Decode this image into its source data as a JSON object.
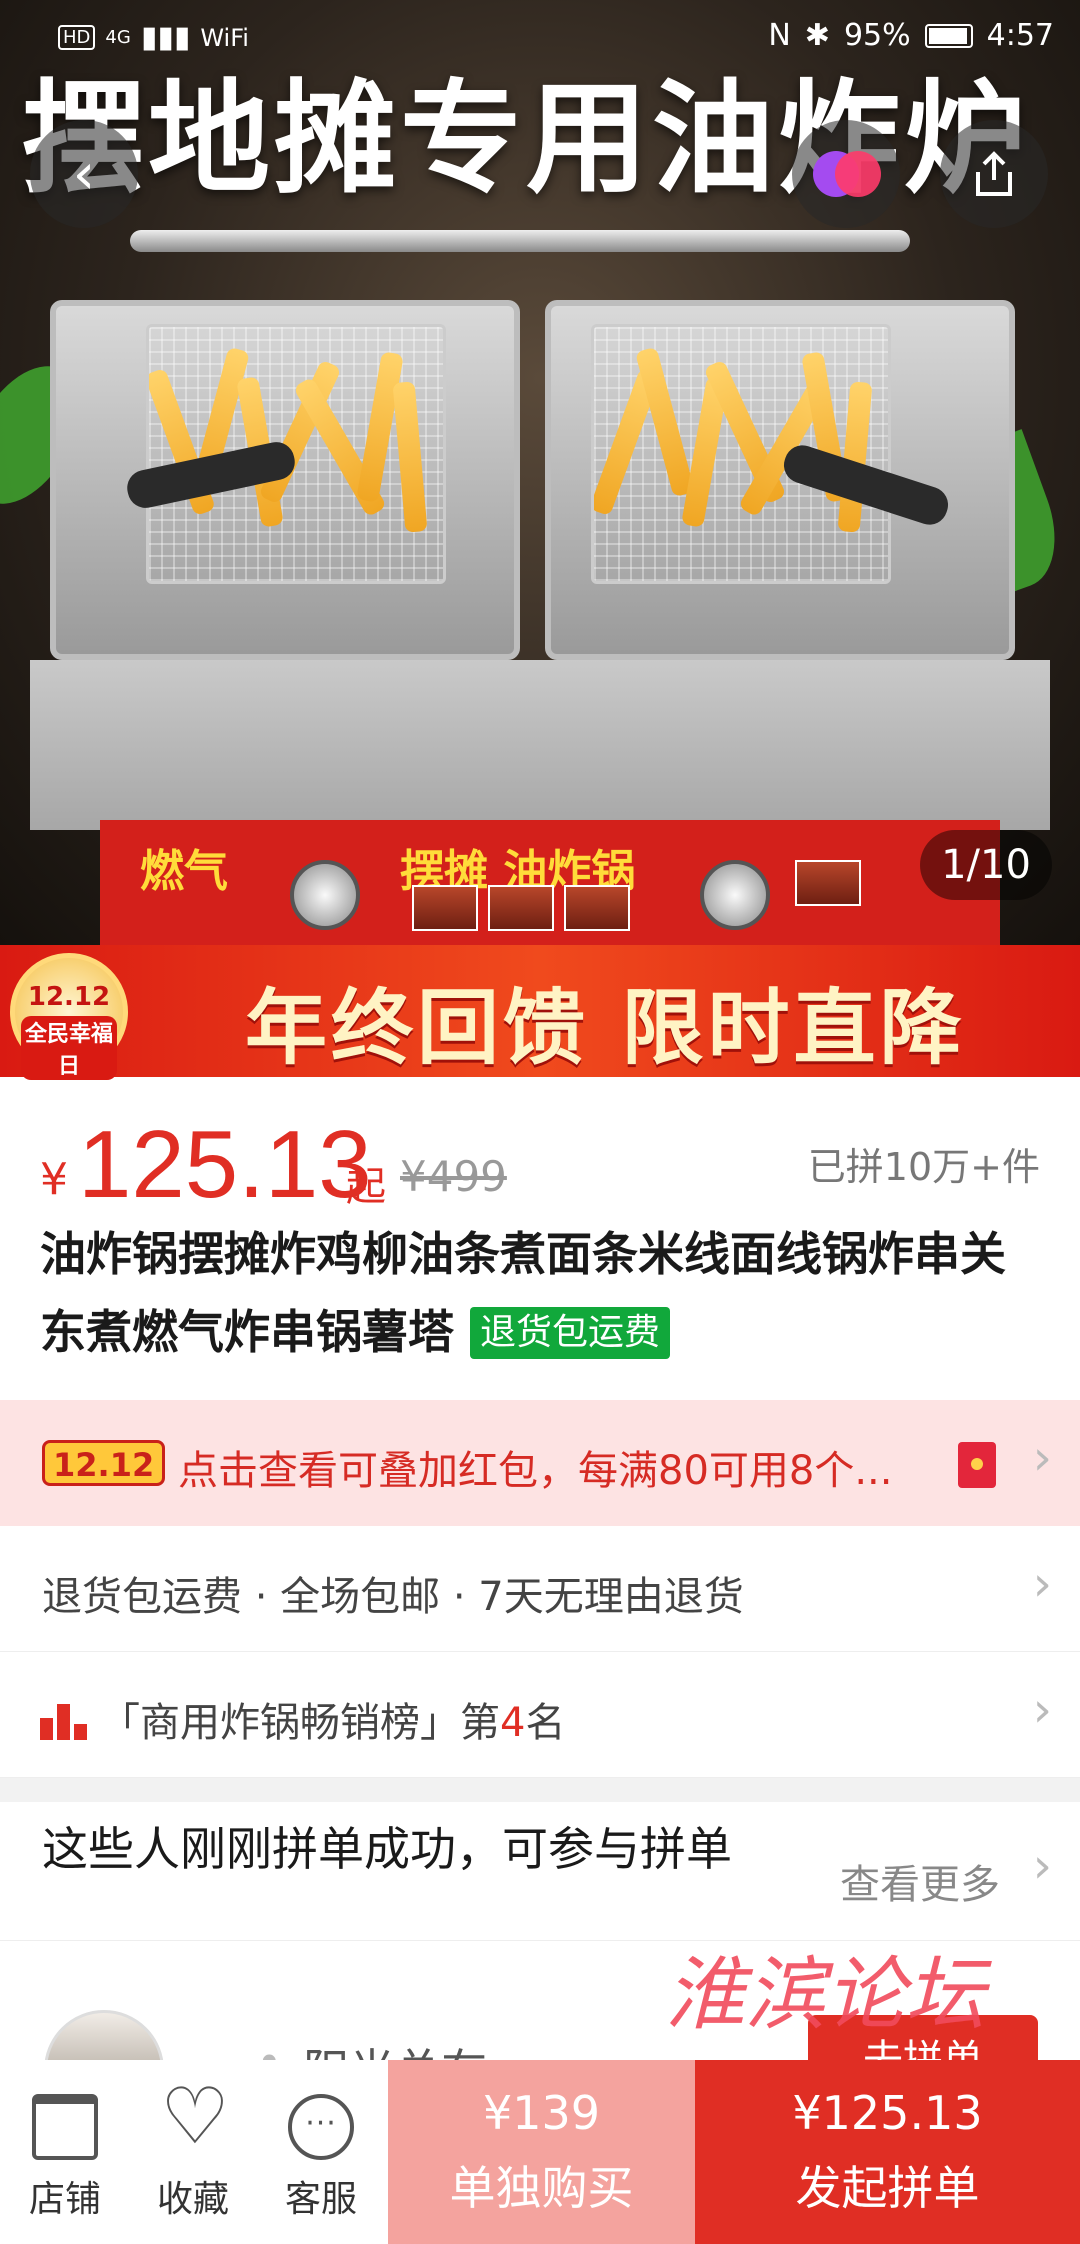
{
  "status_bar": {
    "left": [
      "HD",
      "4G",
      "▮▮▮",
      "WiFi"
    ],
    "battery": "95%",
    "time": "4:57"
  },
  "hero": {
    "title": "摆地摊专用油炸炉",
    "panel_left": "燃气",
    "panel_center": "摆摊 油炸锅",
    "counter": "1/10"
  },
  "header_buttons": {
    "back_icon": "chevron-left-icon",
    "mode_icon": "dual-circle-icon",
    "share_icon": "share-icon"
  },
  "promo_banner": {
    "badge_top": "12.12",
    "badge_bottom": "全民幸福日",
    "text": "年终回馈 限时直降"
  },
  "price": {
    "currency": "¥",
    "value": "125.13",
    "suffix": "起",
    "original": "¥499",
    "sold": "已拼10万+件"
  },
  "product": {
    "title": "油炸锅摆摊炸鸡柳油条煮面条米线面线锅炸串关东煮燃气炸串锅薯塔",
    "tag": "退货包运费"
  },
  "coupon": {
    "badge": "12.12",
    "text": "点击查看可叠加红包，每满80可用8个..."
  },
  "service_row": {
    "text": "退货包运费 · 全场包邮 · 7天无理由退货"
  },
  "rank_row": {
    "prefix": "「商用炸锅畅销榜」第",
    "rank": "4",
    "suffix": "名"
  },
  "group_section": {
    "title": "这些人刚刚拼单成功，可参与拼单",
    "see_more": "查看更多",
    "user_name": "阳光总在",
    "join_label": "去拼单"
  },
  "watermark": "淮滨论坛",
  "bottom_bar": {
    "store_label": "店铺",
    "favorite_label": "收藏",
    "service_label": "客服",
    "single_price": "¥139",
    "single_label": "单独购买",
    "group_price": "¥125.13",
    "group_label": "发起拼单"
  },
  "colors": {
    "accent_red": "#e02e24",
    "tag_green": "#11a83b",
    "coupon_bg": "#fde3e3"
  }
}
